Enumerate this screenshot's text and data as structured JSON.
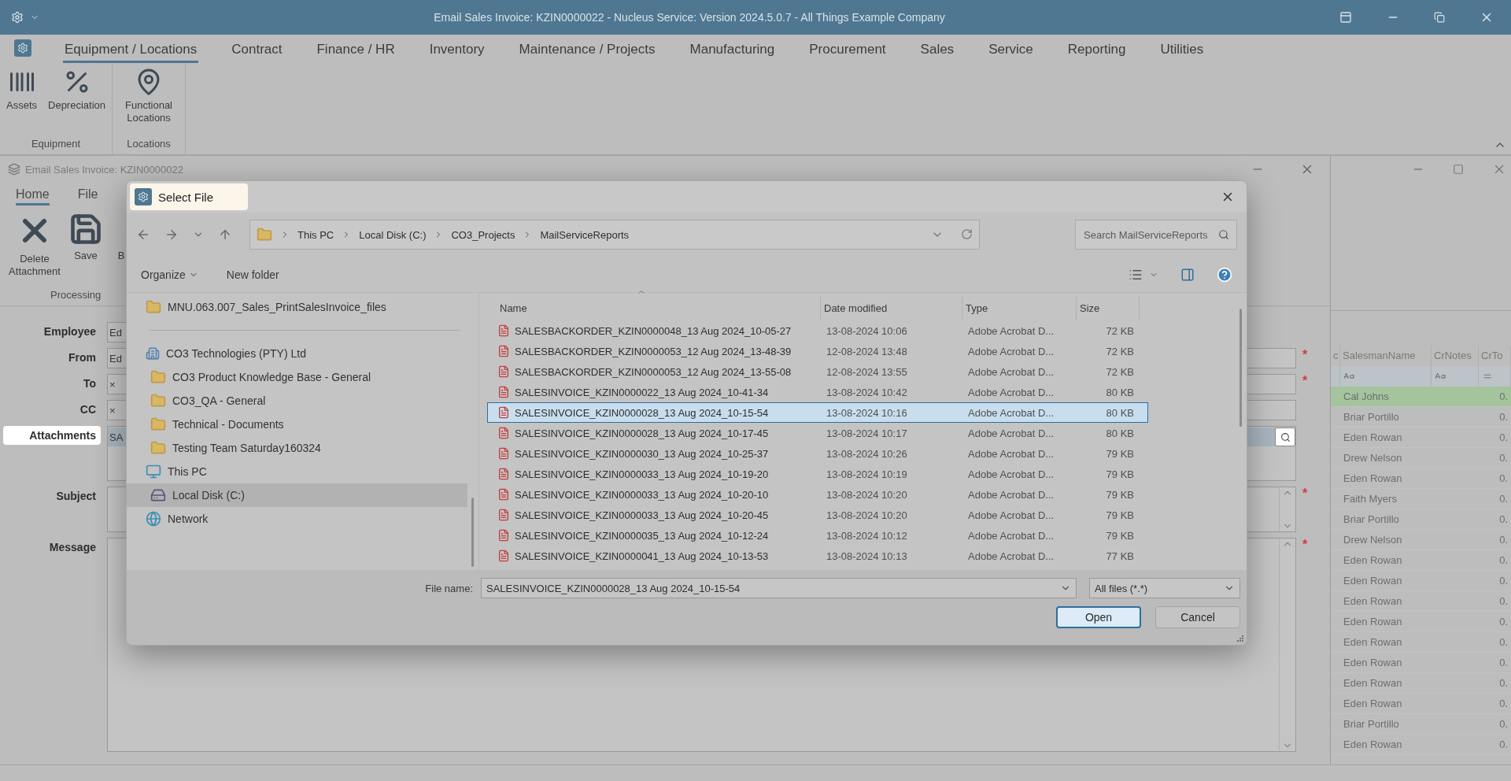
{
  "app_window": {
    "title": "Email Sales Invoice: KZIN0000022 - Nucleus Service: Version 2024.5.0.7 - All Things Example Company",
    "menu_tabs": [
      {
        "label": "Equipment / Locations",
        "selected": true
      },
      {
        "label": "Contract",
        "selected": false
      },
      {
        "label": "Finance / HR",
        "selected": false
      },
      {
        "label": "Inventory",
        "selected": false
      },
      {
        "label": "Maintenance / Projects",
        "selected": false
      },
      {
        "label": "Manufacturing",
        "selected": false
      },
      {
        "label": "Procurement",
        "selected": false
      },
      {
        "label": "Sales",
        "selected": false
      },
      {
        "label": "Service",
        "selected": false
      },
      {
        "label": "Reporting",
        "selected": false
      },
      {
        "label": "Utilities",
        "selected": false
      }
    ],
    "ribbon_groups": [
      {
        "label": "Equipment",
        "buttons": [
          {
            "label": "Assets",
            "kind": "barcode"
          },
          {
            "label": "Depreciation",
            "kind": "percent"
          }
        ]
      },
      {
        "label": "Locations",
        "buttons": [
          {
            "label": "Functional Locations",
            "kind": "pin"
          }
        ]
      }
    ]
  },
  "email_window": {
    "title": "Email Sales Invoice: KZIN0000022",
    "tabs": [
      {
        "label": "Home",
        "selected": true
      },
      {
        "label": "File",
        "selected": false
      }
    ],
    "ribbon_buttons": [
      {
        "label": "Delete Attachment",
        "kind": "delete"
      },
      {
        "label": "Save",
        "kind": "save"
      },
      {
        "label": "B",
        "kind": "back"
      }
    ],
    "ribbon_group": "Processing",
    "fields": [
      {
        "label": "Employee",
        "value": "Ed",
        "kind": "short",
        "highlighted": false
      },
      {
        "label": "From",
        "value": "Ed",
        "kind": "text",
        "required_mark": "*",
        "highlighted": false
      },
      {
        "label": "To",
        "value": "×",
        "kind": "text",
        "required_mark": "*",
        "highlighted": false
      },
      {
        "label": "CC",
        "value": "×",
        "kind": "text",
        "highlighted": false
      },
      {
        "label": "Attachments",
        "value": "SA",
        "kind": "attachments",
        "highlighted": true
      },
      {
        "label": "Subject",
        "kind": "subject",
        "required_mark": "*",
        "highlighted": false
      },
      {
        "label": "Message",
        "kind": "message",
        "required_mark": "*",
        "highlighted": false
      }
    ]
  },
  "grid_window": {
    "columns": [
      "c",
      "SalesmanName",
      "CrNotes",
      "CrTo"
    ],
    "rows": [
      {
        "salesman": "Cal Johns",
        "total": "0.",
        "selected": true
      },
      {
        "salesman": "Briar Portillo",
        "total": "0.",
        "selected": false
      },
      {
        "salesman": "Eden Rowan",
        "total": "0.",
        "selected": false
      },
      {
        "salesman": "Drew Nelson",
        "total": "0.",
        "selected": false
      },
      {
        "salesman": "Eden Rowan",
        "total": "0.",
        "selected": false
      },
      {
        "salesman": "Faith Myers",
        "total": "0.",
        "selected": false
      },
      {
        "salesman": "Briar Portillo",
        "total": "0.",
        "selected": false
      },
      {
        "salesman": "Drew Nelson",
        "total": "0.",
        "selected": false
      },
      {
        "salesman": "Eden Rowan",
        "total": "0.",
        "selected": false
      },
      {
        "salesman": "Eden Rowan",
        "total": "0.",
        "selected": false
      },
      {
        "salesman": "Eden Rowan",
        "total": "0.",
        "selected": false
      },
      {
        "salesman": "Eden Rowan",
        "total": "0.",
        "selected": false
      },
      {
        "salesman": "Eden Rowan",
        "total": "0.",
        "selected": false
      },
      {
        "salesman": "Eden Rowan",
        "total": "0.",
        "selected": false
      },
      {
        "salesman": "Eden Rowan",
        "total": "0.",
        "selected": false
      },
      {
        "salesman": "Eden Rowan",
        "total": "0.",
        "selected": false
      },
      {
        "salesman": "Briar Portillo",
        "total": "0.",
        "selected": false
      },
      {
        "salesman": "Eden Rowan",
        "total": "0.",
        "selected": false
      }
    ]
  },
  "dialog": {
    "title": "Select File",
    "highlighted": true,
    "path": [
      "This PC",
      "Local Disk (C:)",
      "CO3_Projects",
      "MailServiceReports"
    ],
    "search": {
      "placeholder": "Search MailServiceReports"
    },
    "toolbar": {
      "organize": "Organize",
      "new_folder": "New folder"
    },
    "tree": [
      {
        "label": "MNU.063.007_Sales_PrintSalesInvoice_files",
        "kind": "pinned",
        "selected": false
      },
      {
        "label": "CO3 Technologies (PTY) Ltd",
        "kind": "org",
        "selected": false,
        "children": [
          {
            "label": "CO3 Product Knowledge Base - General",
            "kind": "folder",
            "selected": false
          },
          {
            "label": "CO3_QA - General",
            "kind": "folder",
            "selected": false
          },
          {
            "label": "Technical - Documents",
            "kind": "folder",
            "selected": false
          },
          {
            "label": "Testing Team Saturday160324",
            "kind": "folder",
            "selected": false
          }
        ]
      },
      {
        "label": "This PC",
        "kind": "pc",
        "selected": false,
        "children": [
          {
            "label": "Local Disk (C:)",
            "kind": "drive",
            "selected": true
          }
        ]
      },
      {
        "label": "Network",
        "kind": "network",
        "selected": false
      }
    ],
    "columns": [
      "Name",
      "Date modified",
      "Type",
      "Size"
    ],
    "files": [
      {
        "name": "SALESBACKORDER_KZIN0000048_13 Aug 2024_10-05-27",
        "date": "13-08-2024 10:06",
        "type": "Adobe Acrobat D...",
        "size": "72 KB",
        "selected": false
      },
      {
        "name": "SALESBACKORDER_KZIN0000053_12 Aug 2024_13-48-39",
        "date": "12-08-2024 13:48",
        "type": "Adobe Acrobat D...",
        "size": "72 KB",
        "selected": false
      },
      {
        "name": "SALESBACKORDER_KZIN0000053_12 Aug 2024_13-55-08",
        "date": "12-08-2024 13:55",
        "type": "Adobe Acrobat D...",
        "size": "72 KB",
        "selected": false
      },
      {
        "name": "SALESINVOICE_KZIN0000022_13 Aug 2024_10-41-34",
        "date": "13-08-2024 10:42",
        "type": "Adobe Acrobat D...",
        "size": "80 KB",
        "selected": false
      },
      {
        "name": "SALESINVOICE_KZIN0000028_13 Aug 2024_10-15-54",
        "date": "13-08-2024 10:16",
        "type": "Adobe Acrobat D...",
        "size": "80 KB",
        "selected": true
      },
      {
        "name": "SALESINVOICE_KZIN0000028_13 Aug 2024_10-17-45",
        "date": "13-08-2024 10:17",
        "type": "Adobe Acrobat D...",
        "size": "80 KB",
        "selected": false
      },
      {
        "name": "SALESINVOICE_KZIN0000030_13 Aug 2024_10-25-37",
        "date": "13-08-2024 10:26",
        "type": "Adobe Acrobat D...",
        "size": "79 KB",
        "selected": false
      },
      {
        "name": "SALESINVOICE_KZIN0000033_13 Aug 2024_10-19-20",
        "date": "13-08-2024 10:19",
        "type": "Adobe Acrobat D...",
        "size": "79 KB",
        "selected": false
      },
      {
        "name": "SALESINVOICE_KZIN0000033_13 Aug 2024_10-20-10",
        "date": "13-08-2024 10:20",
        "type": "Adobe Acrobat D...",
        "size": "79 KB",
        "selected": false
      },
      {
        "name": "SALESINVOICE_KZIN0000033_13 Aug 2024_10-20-45",
        "date": "13-08-2024 10:20",
        "type": "Adobe Acrobat D...",
        "size": "79 KB",
        "selected": false
      },
      {
        "name": "SALESINVOICE_KZIN0000035_13 Aug 2024_10-12-24",
        "date": "13-08-2024 10:12",
        "type": "Adobe Acrobat D...",
        "size": "79 KB",
        "selected": false
      },
      {
        "name": "SALESINVOICE_KZIN0000041_13 Aug 2024_10-13-53",
        "date": "13-08-2024 10:13",
        "type": "Adobe Acrobat D...",
        "size": "77 KB",
        "selected": false
      }
    ],
    "file_name_label": "File name:",
    "file_name": "SALESINVOICE_KZIN0000028_13 Aug 2024_10-15-54",
    "filter": "All files (*.*)",
    "buttons": [
      {
        "label": "Open",
        "default": true
      },
      {
        "label": "Cancel",
        "default": false
      }
    ]
  }
}
